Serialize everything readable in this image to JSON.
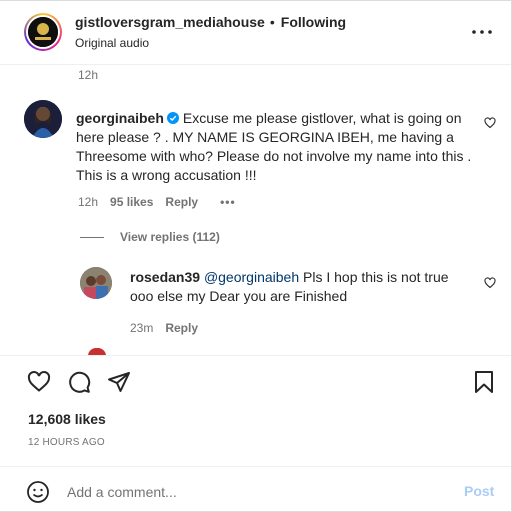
{
  "header": {
    "username": "gistloversgram_mediahouse",
    "separator": "•",
    "follow_status": "Following",
    "audio": "Original audio",
    "more_icon": "more-horizontal-icon"
  },
  "comments": {
    "top_timestamp": "12h",
    "main": {
      "username": "georginaibeh",
      "verified": true,
      "text": "Excuse me please gistlover, what is going on here please ? . MY NAME IS GEORGINA IBEH, me having a Threesome with who? Please do not involve my name into this . This is a wrong accusation !!!",
      "time": "12h",
      "likes": "95 likes",
      "reply_label": "Reply",
      "more": "•••"
    },
    "view_replies": "View replies (112)",
    "reply": {
      "username": "rosedan39",
      "mention": "@georginaibeh",
      "text": " Pls I hop this is not true ooo else my Dear you are Finished",
      "time": "23m",
      "reply_label": "Reply"
    }
  },
  "actions": {
    "like_icon": "heart-icon",
    "comment_icon": "comment-icon",
    "share_icon": "share-icon",
    "save_icon": "bookmark-icon"
  },
  "post": {
    "likes": "12,608 likes",
    "time_ago": "12 HOURS AGO"
  },
  "add_comment": {
    "placeholder": "Add a comment...",
    "post_label": "Post",
    "emoji_icon": "emoji-icon"
  },
  "colors": {
    "text": "#262626",
    "secondary": "#737373",
    "verified": "#0095f6",
    "post_disabled": "#a9cdf6",
    "mention": "#00376b"
  }
}
